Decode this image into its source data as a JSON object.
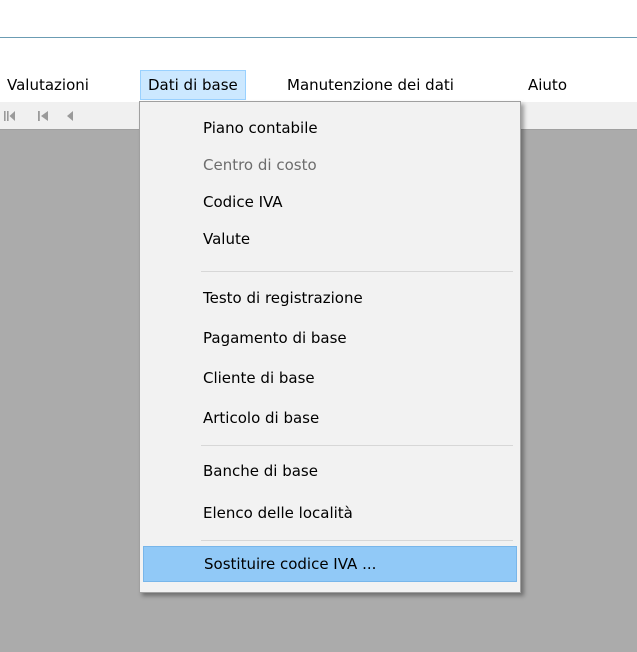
{
  "menubar": {
    "items": [
      {
        "label": "Valutazioni"
      },
      {
        "label": "Dati di base"
      },
      {
        "label": "Manutenzione dei dati"
      },
      {
        "label": "Aiuto"
      }
    ]
  },
  "toolbar": {
    "buttons": [
      "first-record-icon",
      "first-page-icon",
      "previous-record-icon"
    ]
  },
  "dropdown": {
    "items": [
      {
        "label": "Piano contabile"
      },
      {
        "label": "Centro di costo",
        "disabled": true
      },
      {
        "label": "Codice IVA"
      },
      {
        "label": "Valute"
      },
      {
        "label": "Testo di registrazione"
      },
      {
        "label": "Pagamento di base"
      },
      {
        "label": "Cliente di base"
      },
      {
        "label": "Articolo di base"
      },
      {
        "label": "Banche di base"
      },
      {
        "label": "Elenco delle località"
      },
      {
        "label": "Sostituire codice IVA ...",
        "highlighted": true
      }
    ]
  },
  "colors": {
    "highlight": "#91c9f7",
    "open_menu": "#cce8ff",
    "workspace": "#ababab",
    "disabled_text": "#6d6d6d"
  }
}
